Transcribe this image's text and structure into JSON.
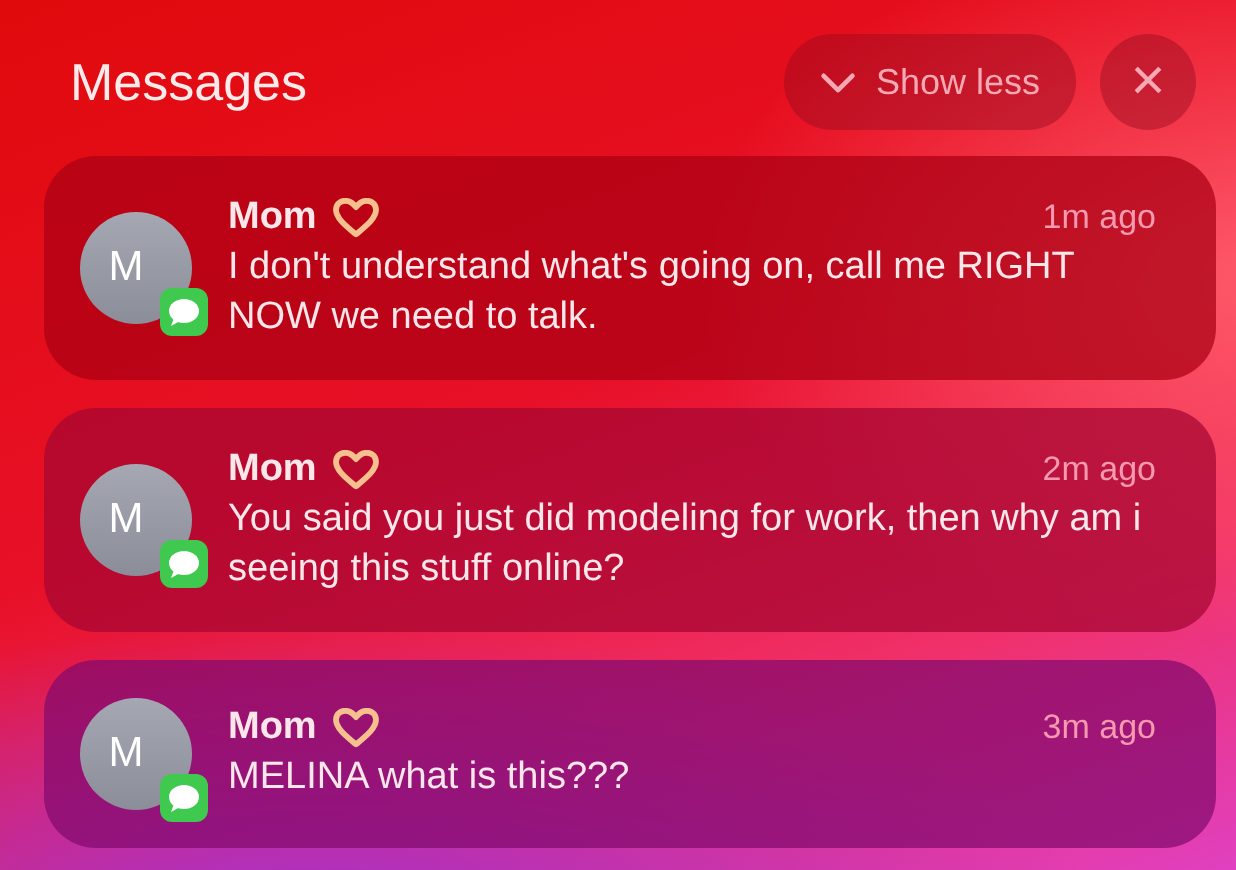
{
  "header": {
    "title": "Messages",
    "show_less": {
      "label": "Show less"
    },
    "close": {
      "label": "×"
    }
  },
  "notifications": [
    {
      "avatar_letter": "M",
      "sender": "Mom",
      "time": "1m ago",
      "message": "I don't understand what's going on, call me RIGHT NOW we need to talk."
    },
    {
      "avatar_letter": "M",
      "sender": "Mom",
      "time": "2m ago",
      "message": "You said you just did modeling for work, then why am i seeing this stuff online?"
    },
    {
      "avatar_letter": "M",
      "sender": "Mom",
      "time": "3m ago",
      "message": "MELINA what is this???"
    }
  ]
}
